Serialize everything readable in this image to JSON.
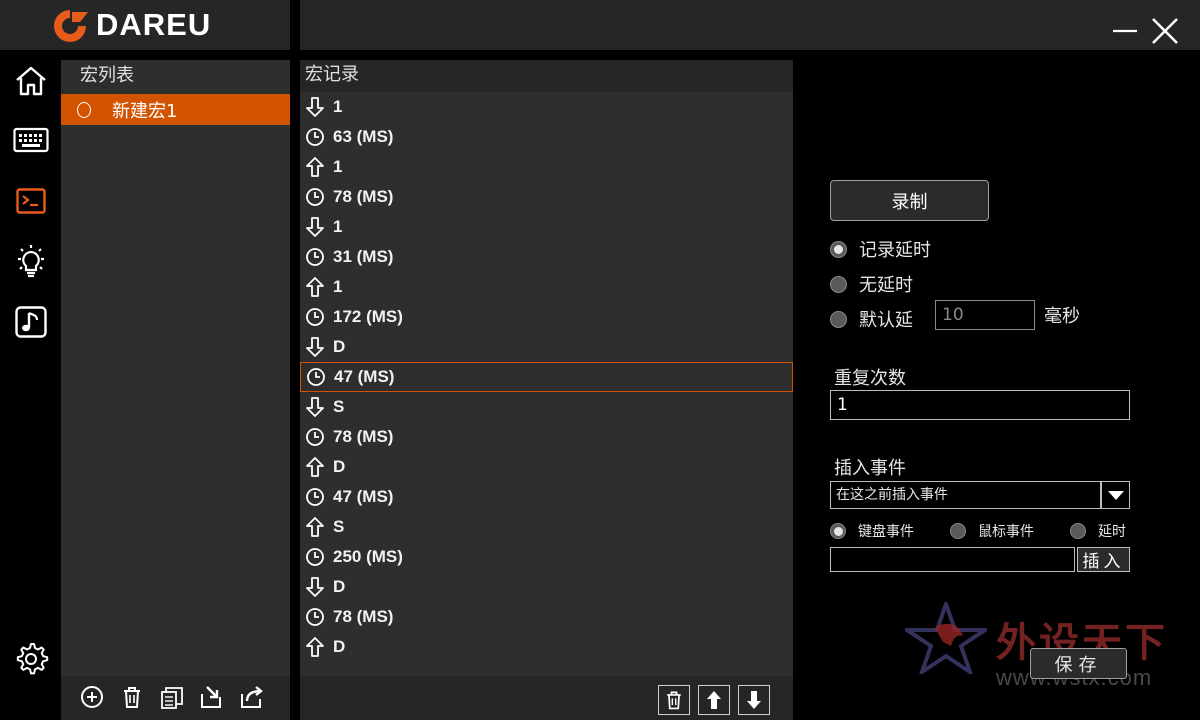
{
  "app": {
    "brand": "DAREU",
    "accent_color": "#d35400"
  },
  "window_controls": {
    "minimize_icon": "minimize-icon",
    "close_icon": "close-icon"
  },
  "nav": [
    {
      "icon": "home-icon"
    },
    {
      "icon": "keyboard-icon"
    },
    {
      "icon": "terminal-macro-icon",
      "active": true
    },
    {
      "icon": "lightbulb-icon"
    },
    {
      "icon": "music-note-icon"
    },
    {
      "icon": "gear-icon"
    }
  ],
  "macro_list": {
    "header": "宏列表",
    "items": [
      {
        "label": "新建宏1",
        "selected": true
      }
    ],
    "footer_icons": [
      "add-icon",
      "delete-icon",
      "copy-icon",
      "import-icon",
      "export-icon"
    ]
  },
  "record": {
    "header": "宏记录",
    "rows": [
      {
        "type": "down",
        "text": "1"
      },
      {
        "type": "delay",
        "text": "63 (MS)"
      },
      {
        "type": "up",
        "text": "1"
      },
      {
        "type": "delay",
        "text": "78 (MS)"
      },
      {
        "type": "down",
        "text": "1"
      },
      {
        "type": "delay",
        "text": "31 (MS)"
      },
      {
        "type": "up",
        "text": "1"
      },
      {
        "type": "delay",
        "text": "172 (MS)"
      },
      {
        "type": "down",
        "text": "D"
      },
      {
        "type": "delay",
        "text": "47 (MS)",
        "selected": true
      },
      {
        "type": "down",
        "text": "S"
      },
      {
        "type": "delay",
        "text": "78 (MS)"
      },
      {
        "type": "up",
        "text": "D"
      },
      {
        "type": "delay",
        "text": "47 (MS)"
      },
      {
        "type": "up",
        "text": "S"
      },
      {
        "type": "delay",
        "text": "250 (MS)"
      },
      {
        "type": "down",
        "text": "D"
      },
      {
        "type": "delay",
        "text": "78 (MS)"
      },
      {
        "type": "up",
        "text": "D"
      }
    ],
    "footer_icons": [
      "delete-icon",
      "move-up-icon",
      "move-down-icon"
    ]
  },
  "controls": {
    "record_button": "录制",
    "delay_options": [
      {
        "label": "记录延时",
        "checked": true
      },
      {
        "label": "无延时",
        "checked": false
      },
      {
        "label": "默认延",
        "checked": false
      }
    ],
    "default_delay_value": "10",
    "delay_unit": "毫秒",
    "repeat_label": "重复次数",
    "repeat_value": "1",
    "insert_label": "插入事件",
    "insert_position": "在这之前插入事件",
    "event_types": [
      {
        "label": "键盘事件",
        "checked": true
      },
      {
        "label": "鼠标事件",
        "checked": false
      },
      {
        "label": "延时",
        "checked": false
      }
    ],
    "insert_button": "插入",
    "save_button": "保存"
  },
  "watermark": {
    "text": "外设天下",
    "url": "www.wstx.com"
  }
}
